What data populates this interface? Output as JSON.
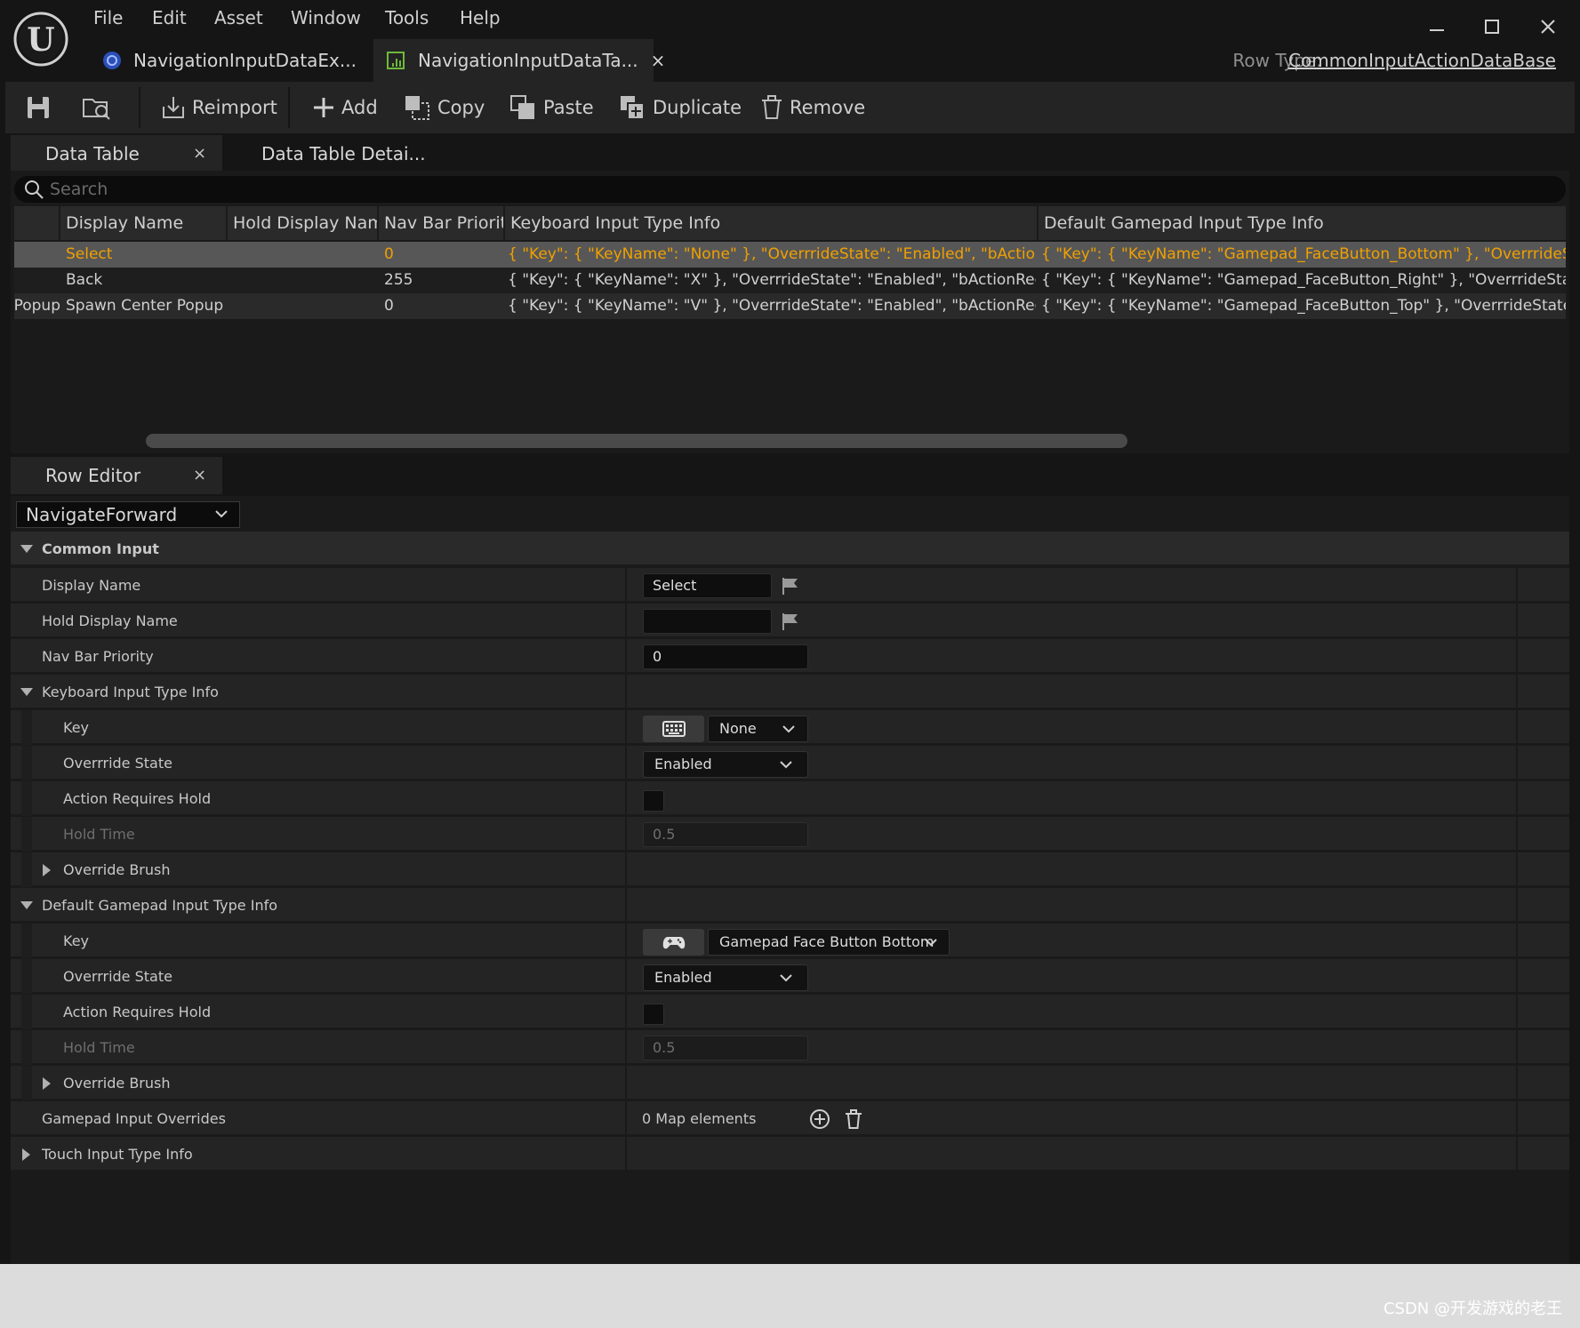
{
  "menu": [
    "File",
    "Edit",
    "Asset",
    "Window",
    "Tools",
    "Help"
  ],
  "doc_tabs": [
    {
      "label": "NavigationInputDataEx..."
    },
    {
      "label": "NavigationInputDataTa...",
      "close": "×"
    }
  ],
  "row_type": {
    "label": "Row Type:",
    "value": "CommonInputActionDataBase"
  },
  "toolbar": {
    "reimport": "Reimport",
    "add": "Add",
    "copy": "Copy",
    "paste": "Paste",
    "duplicate": "Duplicate",
    "remove": "Remove"
  },
  "data_table_panel": {
    "tabs": [
      {
        "label": "Data Table",
        "close": "×"
      },
      {
        "label": "Data Table Detai..."
      }
    ],
    "search_placeholder": "Search",
    "columns": [
      "Display Name",
      "Hold Display Name",
      "Nav Bar Priority",
      "Keyboard Input Type Info",
      "Default Gamepad Input Type Info"
    ],
    "rows": [
      {
        "row_name": "",
        "display_name": "Select",
        "hold_display_name": "",
        "nav_bar_priority": "0",
        "keyboard": "{ \"Key\": { \"KeyName\": \"None\" }, \"OverrrideState\": \"Enabled\", \"bActionRequiresHold\": false",
        "gamepad": "{ \"Key\": { \"KeyName\": \"Gamepad_FaceButton_Bottom\" }, \"OverrrideState\": \"Enabled\""
      },
      {
        "row_name": "",
        "display_name": "Back",
        "hold_display_name": "",
        "nav_bar_priority": "255",
        "keyboard": "{ \"Key\": { \"KeyName\": \"X\" }, \"OverrrideState\": \"Enabled\", \"bActionRequiresHold\": false",
        "gamepad": "{ \"Key\": { \"KeyName\": \"Gamepad_FaceButton_Right\" }, \"OverrrideState\": \"Enabled\""
      },
      {
        "row_name": "rPopup",
        "display_name": "Spawn Center Popup",
        "hold_display_name": "",
        "nav_bar_priority": "0",
        "keyboard": "{ \"Key\": { \"KeyName\": \"V\" }, \"OverrrideState\": \"Enabled\", \"bActionRequiresHold\": false",
        "gamepad": "{ \"Key\": { \"KeyName\": \"Gamepad_FaceButton_Top\" }, \"OverrrideState\": \"Enabled\""
      }
    ]
  },
  "row_editor": {
    "tab": {
      "label": "Row Editor",
      "close": "×"
    },
    "selected_row": "NavigateForward",
    "common_input": {
      "label": "Common Input",
      "display_name": {
        "label": "Display Name",
        "value": "Select"
      },
      "hold_display_name": {
        "label": "Hold Display Name",
        "value": ""
      },
      "nav_bar_priority": {
        "label": "Nav Bar Priority",
        "value": "0"
      }
    },
    "keyboard": {
      "label": "Keyboard Input Type Info",
      "key": {
        "label": "Key",
        "value": "None"
      },
      "override_state": {
        "label": "Overrride State",
        "value": "Enabled"
      },
      "action_requires_hold": {
        "label": "Action Requires Hold",
        "checked": false
      },
      "hold_time": {
        "label": "Hold Time",
        "value": "0.5"
      },
      "override_brush": {
        "label": "Override Brush"
      }
    },
    "gamepad": {
      "label": "Default Gamepad Input Type Info",
      "key": {
        "label": "Key",
        "value": "Gamepad Face Button Bottom"
      },
      "override_state": {
        "label": "Overrride State",
        "value": "Enabled"
      },
      "action_requires_hold": {
        "label": "Action Requires Hold",
        "checked": false
      },
      "hold_time": {
        "label": "Hold Time",
        "value": "0.5"
      },
      "override_brush": {
        "label": "Override Brush"
      }
    },
    "gamepad_overrides": {
      "label": "Gamepad Input Overrides",
      "value": "0 Map elements"
    },
    "touch": {
      "label": "Touch Input Type Info"
    }
  },
  "watermark": "CSDN @开发游戏的老王",
  "colors": {
    "selected_row_text": "#f0a000",
    "app_bg": "#151515",
    "panel_bg": "#242424"
  }
}
